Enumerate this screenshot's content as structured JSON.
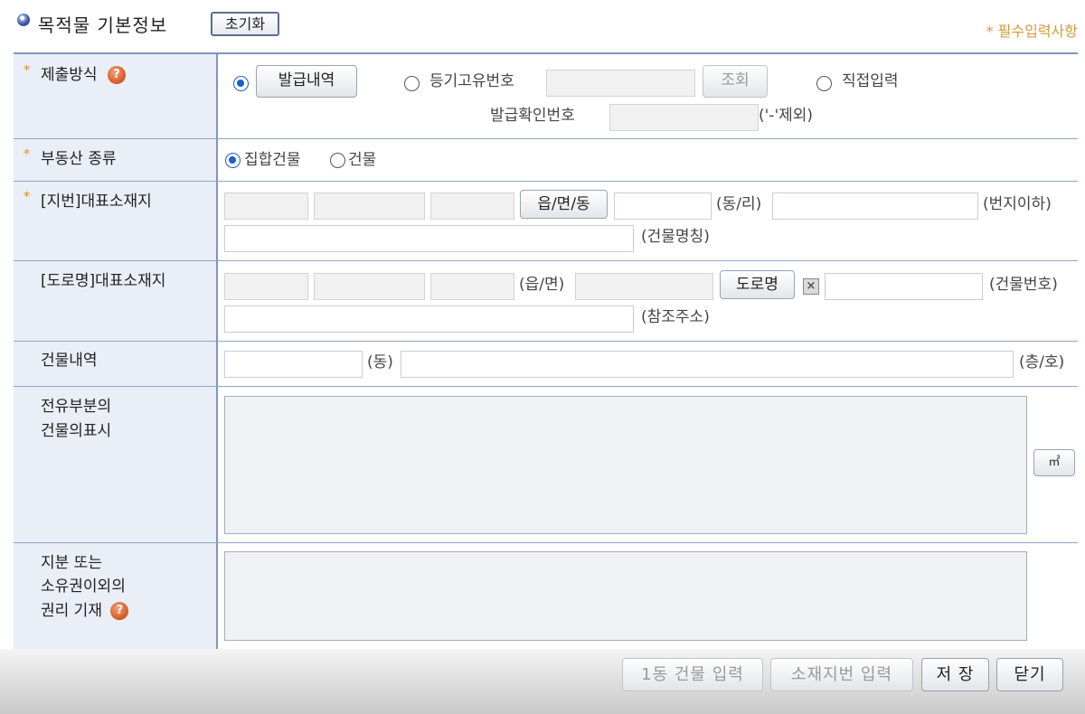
{
  "header": {
    "title": "목적물 기본정보",
    "reset_label": "초기화",
    "required_note": "* 필수입력사항"
  },
  "help_glyph": "?",
  "star_glyph": "*",
  "rows": {
    "submission": {
      "label": "제출방식",
      "option_issued": "발급내역",
      "option_registry": "등기고유번호",
      "lookup_label": "조회",
      "option_direct": "직접입력",
      "confirm_label": "발급확인번호",
      "confirm_note": "('-'제외)",
      "selected": "발급내역"
    },
    "property_type": {
      "label": "부동산 종류",
      "option_collective": "집합건물",
      "option_building": "건물",
      "selected": "집합건물"
    },
    "lot_address": {
      "label": "[지번]대표소재지",
      "town_button": "읍/면/동",
      "dong_ri": "(동/리)",
      "lot_below": "(번지이하)",
      "building_name": "(건물명칭)"
    },
    "road_address": {
      "label": "[도로명]대표소재지",
      "eup_myeon": "(읍/면)",
      "road_button": "도로명",
      "clear_glyph": "×",
      "building_no": "(건물번호)",
      "reference": "(참조주소)"
    },
    "building_detail": {
      "label": "건물내역",
      "dong": "(동)",
      "floor_ho": "(층/호)"
    },
    "exclusive_part": {
      "label_line1": "전유부분의",
      "label_line2": "건물의표시",
      "unit_button": "㎡"
    },
    "rights": {
      "label_line1": "지분 또는",
      "label_line2": "소유권이외의",
      "label_line3": "권리 기재"
    }
  },
  "footer": {
    "one_building": "1동 건물 입력",
    "lot_input": "소재지번 입력",
    "save": "저 장",
    "close": "닫기"
  },
  "colors": {
    "label_bg": "#e9eef7",
    "border": "#7e96b8",
    "required_star": "#e08a1e",
    "radio_on": "#1a5fd0"
  }
}
